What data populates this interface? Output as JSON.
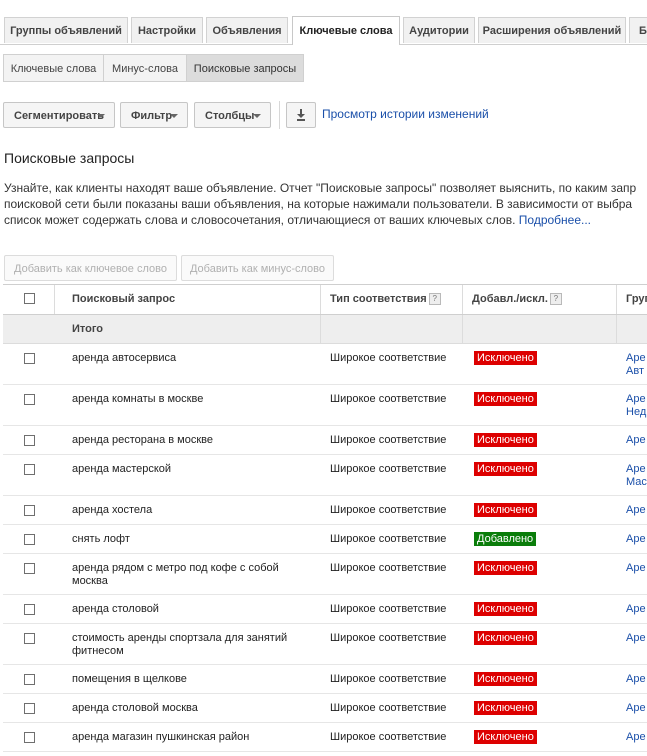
{
  "colors": {
    "excluded": "#dd0000",
    "added": "#0a7d0a",
    "link": "#1a4fa9"
  },
  "tabs": [
    {
      "label": "Группы объявлений"
    },
    {
      "label": "Настройки"
    },
    {
      "label": "Объявления"
    },
    {
      "label": "Ключевые слова",
      "active": true
    },
    {
      "label": "Аудитории"
    },
    {
      "label": "Расширения объявлений"
    },
    {
      "label": "Б"
    }
  ],
  "subtabs": [
    {
      "label": "Ключевые слова"
    },
    {
      "label": "Минус-слова"
    },
    {
      "label": "Поисковые запросы",
      "active": true
    }
  ],
  "toolbar": {
    "segment": "Сегментировать",
    "filter": "Фильтр",
    "columns": "Столбцы",
    "download_icon": "download-icon",
    "history_link": "Просмотр истории изменений"
  },
  "page_title": "Поисковые запросы",
  "intro": {
    "line1": "Узнайте, как клиенты находят ваше объявление. Отчет \"Поисковые запросы\" позволяет выяснить, по каким запр",
    "line2": "поисковой сети были показаны ваши объявления, на которые нажимали пользователи. В зависимости от выбра",
    "line3": "список может содержать слова и словосочетания, отличающиеся от ваших ключевых слов.",
    "more_link": "Подробнее..."
  },
  "actions": {
    "add_keyword": "Добавить как ключевое слово",
    "add_negative": "Добавить как минус-слово"
  },
  "table": {
    "headers": {
      "query": "Поисковый запрос",
      "match_type": "Тип соответствия",
      "added_excluded": "Добавл./искл.",
      "ad_group": "Груп",
      "help": "?"
    },
    "total_label": "Итого",
    "rows": [
      {
        "query": "аренда автосервиса",
        "match": "Широкое соответствие",
        "status": "Исключено",
        "kind": "excluded",
        "group": "Аре",
        "group2": "Авт"
      },
      {
        "query": "аренда комнаты в москве",
        "match": "Широкое соответствие",
        "status": "Исключено",
        "kind": "excluded",
        "group": "Аре",
        "group2": "Нед"
      },
      {
        "query": "аренда ресторана в москве",
        "match": "Широкое соответствие",
        "status": "Исключено",
        "kind": "excluded",
        "group": "Аре",
        "group2": ""
      },
      {
        "query": "аренда мастерской",
        "match": "Широкое соответствие",
        "status": "Исключено",
        "kind": "excluded",
        "group": "Аре",
        "group2": "Мас"
      },
      {
        "query": "аренда хостела",
        "match": "Широкое соответствие",
        "status": "Исключено",
        "kind": "excluded",
        "group": "Аре",
        "group2": ""
      },
      {
        "query": "снять лофт",
        "match": "Широкое соответствие",
        "status": "Добавлено",
        "kind": "added",
        "group": "Аре",
        "group2": ""
      },
      {
        "query": "аренда рядом с метро под кофе с собой москва",
        "match": "Широкое соответствие",
        "status": "Исключено",
        "kind": "excluded",
        "group": "Аре",
        "group2": ""
      },
      {
        "query": "аренда столовой",
        "match": "Широкое соответствие",
        "status": "Исключено",
        "kind": "excluded",
        "group": "Аре",
        "group2": ""
      },
      {
        "query": "стоимость аренды спортзала для занятий фитнесом",
        "match": "Широкое соответствие",
        "status": "Исключено",
        "kind": "excluded",
        "group": "Аре",
        "group2": ""
      },
      {
        "query": "помещения в щелкове",
        "match": "Широкое соответствие",
        "status": "Исключено",
        "kind": "excluded",
        "group": "Аре",
        "group2": ""
      },
      {
        "query": "аренда столовой москва",
        "match": "Широкое соответствие",
        "status": "Исключено",
        "kind": "excluded",
        "group": "Аре",
        "group2": ""
      },
      {
        "query": "аренда магазин пушкинская район",
        "match": "Широкое соответствие",
        "status": "Исключено",
        "kind": "excluded",
        "group": "Аре",
        "group2": ""
      }
    ]
  }
}
